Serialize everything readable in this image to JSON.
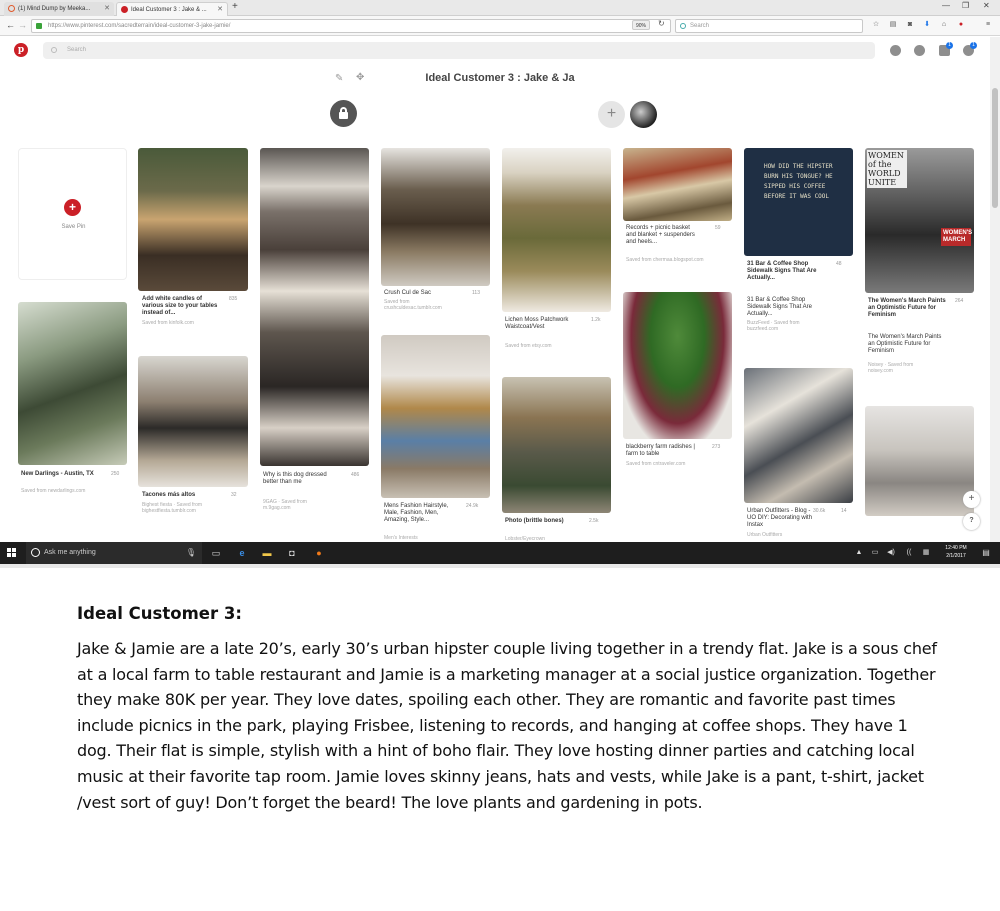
{
  "browser": {
    "tabs": [
      {
        "title": "(1) Mind Dump by Meeka..."
      },
      {
        "title": "Ideal Customer 3 : Jake & ..."
      }
    ],
    "url": "https://www.pinterest.com/sacredterrain/ideal-customer-3-jake-jamie/",
    "zoom": "90%",
    "search_placeholder": "Search"
  },
  "pinterest": {
    "search_placeholder": "Search",
    "notification_count": "1",
    "board_title": "Ideal Customer 3 : Jake & Ja",
    "save_pin_label": "Save Pin",
    "pins": [
      {
        "title": "Add white candles of various size to your tables instead of...",
        "saves": "835",
        "source": "Saved from kinfolk.com"
      },
      {
        "title": "New Darlings - Austin, TX",
        "saves": "250",
        "source": "Saved from newdarlings.com"
      },
      {
        "title": "Tacones más altos",
        "saves": "32",
        "source": "Bighest fiesta · Saved from bighestfiesta.tumblr.com"
      },
      {
        "title": "Why is this dog dressed better than me",
        "saves": "486",
        "source": "9GAG · Saved from m.9gag.com"
      },
      {
        "title": "Crush Cul de Sac",
        "saves": "113",
        "source": "Saved from crushculdesac.tumblr.com"
      },
      {
        "title": "Mens Fashion Hairstyle, Male, Fashion, Men, Amazing, Style...",
        "saves": "24.9k",
        "source": "Men's Interests"
      },
      {
        "title": "Lichen Moss Patchwork Waistcoat/Vest",
        "saves": "1.2k",
        "source": "Saved from etsy.com"
      },
      {
        "title": "Photo (brittle bones)",
        "saves": "2.5k",
        "source": "Lobster/Eyecrown"
      },
      {
        "title": "Records + picnic basket and blanket + suspenders and heels...",
        "saves": "59",
        "source": "Saved from chermaa.blogspot.com"
      },
      {
        "title": "blackberry farm radishes | farm to table",
        "saves": "273",
        "source": "Saved from cntraveler.com"
      },
      {
        "title": "31 Bar & Coffee Shop Sidewalk Signs That Are Actually...",
        "desc": "31 Bar & Coffee Shop Sidewalk Signs That Are Actually...",
        "saves": "48",
        "source": "BuzzFeed · Saved from buzzfeed.com"
      },
      {
        "title": "Urban Outfitters - Blog - UO DIY: Decorating with Instax",
        "saves": "30.6k",
        "likes": "14",
        "source": "Urban Outfitters"
      },
      {
        "title": "The Women's March Paints an Optimistic Future for Feminism",
        "desc": "The Women's March Paints an Optimistic Future for Feminism",
        "saves": "264",
        "source": "Noisey · Saved from noisey.com"
      }
    ],
    "sign_text": "HOW DID THE HIPSTER BURN HIS TONGUE? HE SIPPED HIS COFFEE BEFORE IT WAS COOL",
    "poster_text": "WOMEN of the WORLD UNITE",
    "march_text": "WOMEN'S MARCH"
  },
  "taskbar": {
    "search_placeholder": "Ask me anything",
    "time": "12:40 PM",
    "date": "2/1/2017"
  },
  "document": {
    "heading": "Ideal Customer 3:",
    "body": "Jake & Jamie are a late 20’s, early 30’s urban hipster couple living together in a trendy flat. Jake is a sous chef at a local farm to table restaurant and Jamie is a marketing manager at a social justice organization. Together they make 80K per year. They love dates, spoiling each other. They are romantic and favorite past times include picnics in the park, playing Frisbee, listening to records, and hanging at coffee shops. They have 1 dog. Their flat is simple, stylish with a hint of boho flair. They love hosting dinner parties and catching local music at their favorite tap room. Jamie loves skinny jeans, hats and vests, while Jake is a pant, t-shirt, jacket /vest sort of guy! Don’t forget the beard! The love plants and gardening in pots."
  }
}
